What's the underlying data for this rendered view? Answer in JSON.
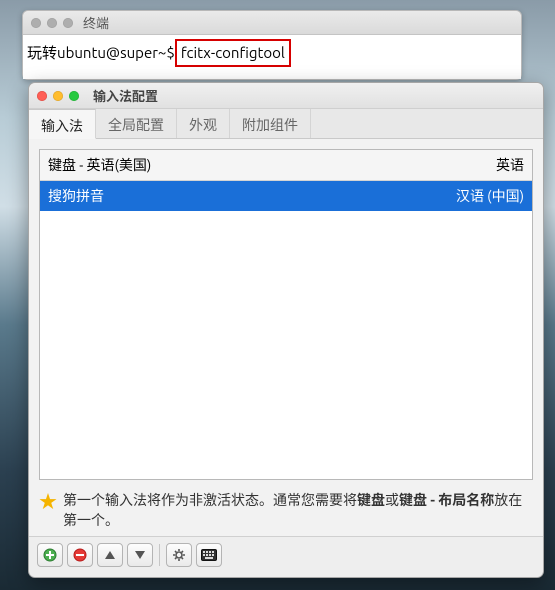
{
  "terminal": {
    "title": "终端",
    "prompt": "玩转ubuntu@super~$",
    "command": "fcitx-configtool"
  },
  "config_window": {
    "title": "输入法配置",
    "tabs": [
      {
        "label": "输入法",
        "active": true
      },
      {
        "label": "全局配置",
        "active": false
      },
      {
        "label": "外观",
        "active": false
      },
      {
        "label": "附加组件",
        "active": false
      }
    ],
    "list": {
      "header_left": "键盘 - 英语(美国)",
      "header_right": "英语",
      "rows": [
        {
          "left": "搜狗拼音",
          "right": "汉语 (中国)",
          "selected": true
        }
      ]
    },
    "hint_parts": {
      "pre": "第一个输入法将作为非激活状态。通常您需要将",
      "bold1": "键盘",
      "mid": "或",
      "bold2": "键盘 - 布局名称",
      "post": "放在第一个。"
    },
    "toolbar": {
      "add": "+",
      "remove": "−",
      "up": "▲",
      "down": "▼",
      "configure": "⚙",
      "keyboard": "⌨"
    }
  }
}
